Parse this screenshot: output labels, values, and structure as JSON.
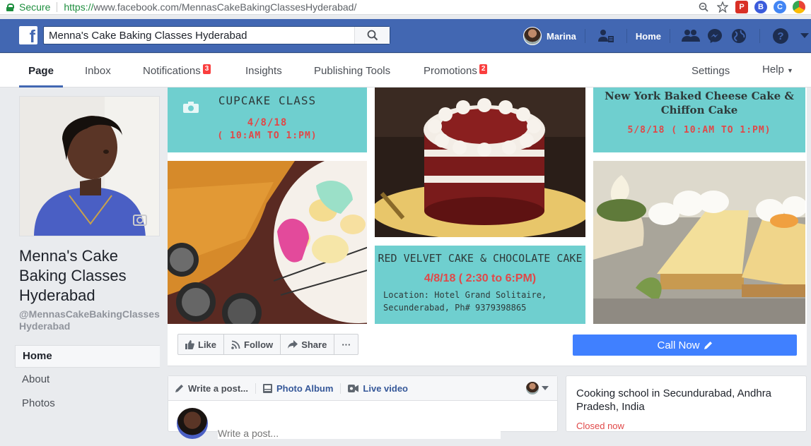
{
  "browser": {
    "secure_label": "Secure",
    "url_proto": "https://",
    "url_rest": "www.facebook.com/MennasCakeBakingClassesHyderabad/"
  },
  "topbar": {
    "logo": "f",
    "search_value": "Menna's Cake Baking Classes Hyderabad",
    "user_name": "Marina",
    "home_label": "Home"
  },
  "tabs": {
    "page": "Page",
    "inbox": "Inbox",
    "notifications": "Notifications",
    "notifications_count": "3",
    "insights": "Insights",
    "publishing_tools": "Publishing Tools",
    "promotions": "Promotions",
    "promotions_count": "2",
    "settings": "Settings",
    "help": "Help"
  },
  "page": {
    "name": "Menna's Cake Baking Classes Hyderabad",
    "handle": "@MennasCakeBakingClassesHyderabad"
  },
  "leftnav": [
    "Home",
    "About",
    "Photos"
  ],
  "cover": {
    "cupcake_title": "CUPCAKE CLASS",
    "cupcake_date": "4/8/18",
    "cupcake_time": "( 10:AM TO 1:PM)",
    "cheesecake_title": "New York Baked Cheese Cake & Chiffon Cake",
    "cheesecake_time": "5/8/18 ( 10:AM TO 1:PM)",
    "redvelvet_title": "RED VELVET CAKE & CHOCOLATE CAKE",
    "redvelvet_time": "4/8/18 ( 2:30 to 6:PM)",
    "location_line1": "Location: Hotel Grand Solitaire,",
    "location_line2": "Secunderabad, Ph# 9379398865"
  },
  "actions": {
    "like": "Like",
    "follow": "Follow",
    "share": "Share",
    "more": "···",
    "call_now": "Call Now"
  },
  "composer": {
    "write_post": "Write a post...",
    "photo_album": "Photo Album",
    "live_video": "Live video",
    "placeholder": "Write a post..."
  },
  "about": {
    "category": "Cooking school in Secundurabad, Andhra Pradesh, India",
    "status": "Closed now"
  }
}
